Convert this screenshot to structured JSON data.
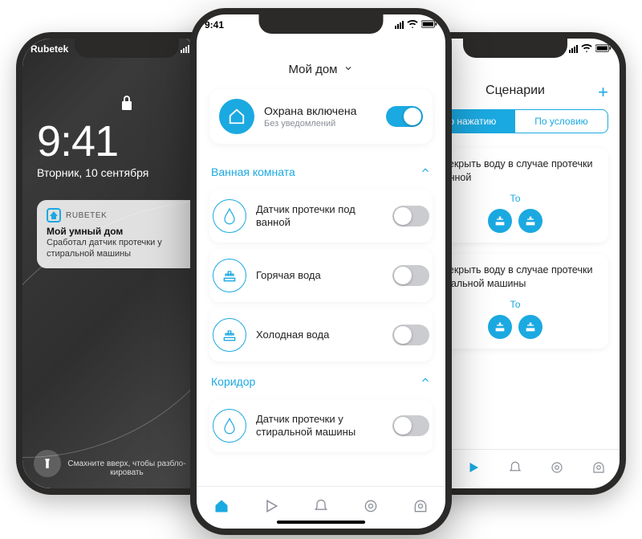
{
  "status": {
    "time": "9:41"
  },
  "left": {
    "carrier": "Rubetek",
    "time": "9:41",
    "date": "Вторник, 10 сентября",
    "notification": {
      "app": "RUBETEK",
      "title": "Мой умный дом",
      "body": "Сработал датчик протечки у стиральной машины"
    },
    "swipe_hint": "Смахните вверх, чтобы разбло­кировать"
  },
  "center": {
    "header": "Мой дом",
    "alarm": {
      "title": "Охрана включена",
      "sub": "Без уведомлений",
      "on": true
    },
    "sections": [
      {
        "title": "Ванная комната",
        "rows": [
          {
            "label": "Датчик протечки под ванной",
            "icon": "water-drop-icon",
            "on": false
          },
          {
            "label": "Горячая вода",
            "icon": "valve-icon",
            "on": false
          },
          {
            "label": "Холодная вода",
            "icon": "valve-icon",
            "on": false
          }
        ]
      },
      {
        "title": "Коридор",
        "rows": [
          {
            "label": "Датчик протечки у стиральной машины",
            "icon": "water-drop-icon",
            "on": false
          }
        ]
      }
    ]
  },
  "right": {
    "title": "Сценарии",
    "segments": {
      "active": "По нажатию",
      "inactive": "По условию"
    },
    "scenarios": [
      {
        "title": "Перекрыть воду в случае протечки в ванной",
        "to": "То"
      },
      {
        "title": "Перекрыть воду в случае протечки стиральной машины",
        "to": "То"
      }
    ]
  }
}
